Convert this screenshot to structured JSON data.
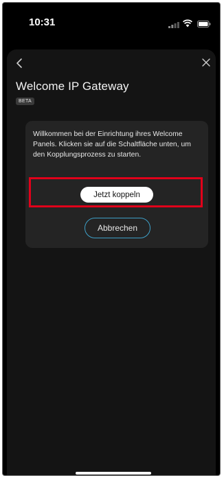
{
  "status_bar": {
    "time": "10:31",
    "icons": [
      "signal-icon",
      "wifi-icon",
      "battery-icon"
    ]
  },
  "sheet": {
    "back_icon": "back-chevron-icon",
    "close_icon": "close-icon",
    "title": "Welcome IP Gateway",
    "badge": "BETA"
  },
  "card": {
    "message": "Willkommen bei der Einrichtung ihres Welcome Panels. Klicken sie auf die Schaltfläche unten, um den Kopplungsprozess zu starten.",
    "primary_button": "Jetzt koppeln",
    "secondary_button": "Abbrechen"
  },
  "colors": {
    "background": "#000000",
    "sheet": "#141414",
    "card": "#242424",
    "highlight": "#e1001a",
    "cancel_border": "#3ea0c8"
  }
}
